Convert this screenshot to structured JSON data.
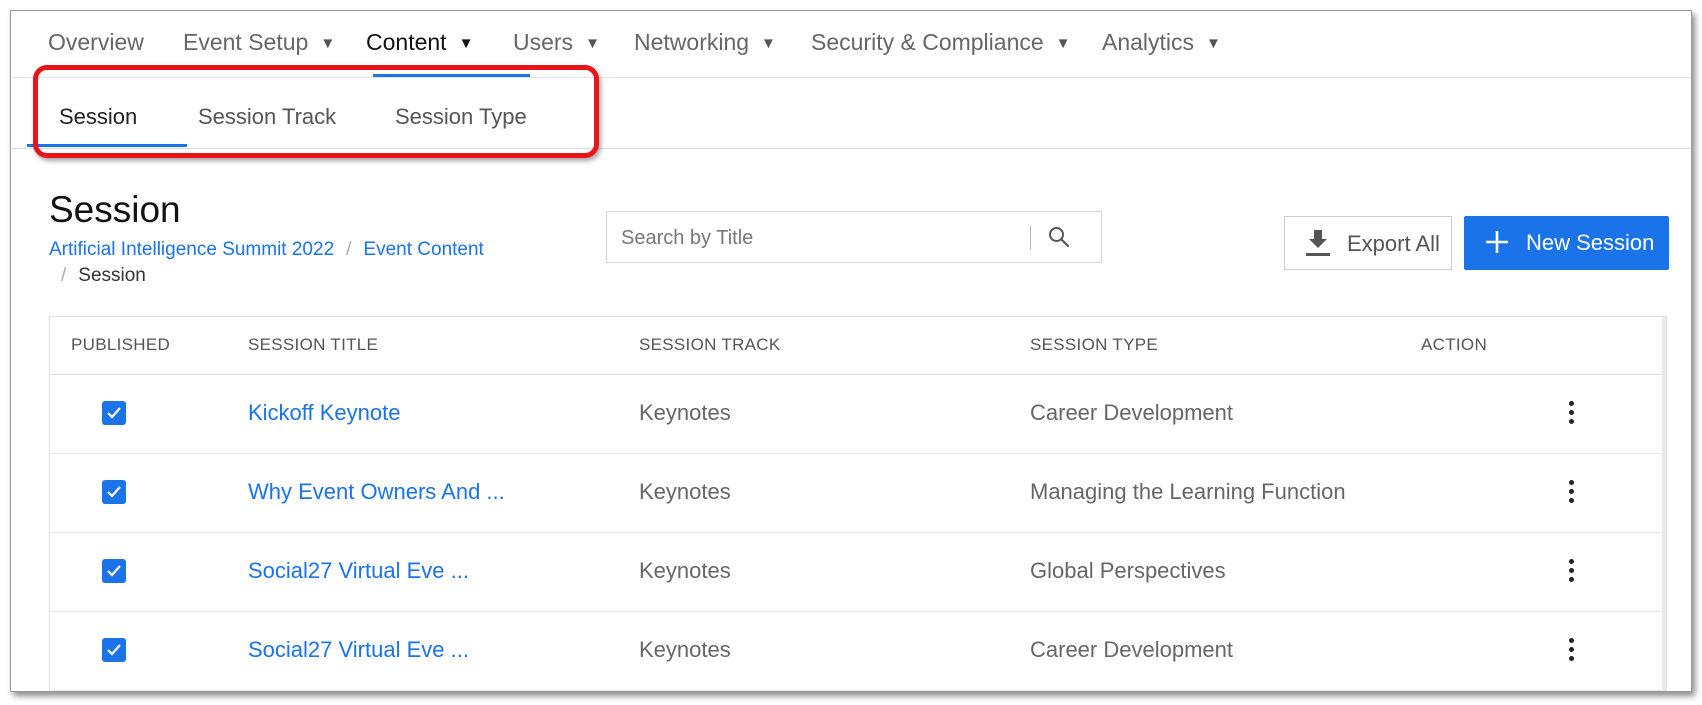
{
  "topnav": {
    "items": [
      {
        "label": "Overview",
        "caret": ""
      },
      {
        "label": "Event Setup",
        "caret": "▼"
      },
      {
        "label": "Content",
        "caret": "▼"
      },
      {
        "label": "Users",
        "caret": "▼"
      },
      {
        "label": "Networking",
        "caret": "▼"
      },
      {
        "label": "Security & Compliance",
        "caret": "▼"
      },
      {
        "label": "Analytics",
        "caret": "▼"
      }
    ],
    "active": "Content"
  },
  "subtabs": {
    "items": [
      {
        "label": "Session"
      },
      {
        "label": "Session Track"
      },
      {
        "label": "Session Type"
      }
    ],
    "active": "Session"
  },
  "page": {
    "title": "Session",
    "breadcrumb": {
      "event": "Artificial Intelligence Summit 2022",
      "section": "Event Content",
      "current": "Session",
      "separator": "/"
    }
  },
  "search": {
    "placeholder": "Search by Title",
    "value": "",
    "icon": "search-icon"
  },
  "actions": {
    "export_label": "Export All",
    "export_icon": "download-icon",
    "new_label": "New Session",
    "new_icon": "plus-icon"
  },
  "table": {
    "columns": [
      "PUBLISHED",
      "SESSION TITLE",
      "SESSION TRACK",
      "SESSION TYPE",
      "ACTION"
    ],
    "rows": [
      {
        "published": true,
        "title": "Kickoff Keynote",
        "track": "Keynotes",
        "type": "Career Development"
      },
      {
        "published": true,
        "title": "Why Event Owners And ...",
        "track": "Keynotes",
        "type": "Managing the Learning Function"
      },
      {
        "published": true,
        "title": "Social27 Virtual Eve ...",
        "track": "Keynotes",
        "type": "Global Perspectives"
      },
      {
        "published": true,
        "title": "Social27 Virtual Eve ...",
        "track": "Keynotes",
        "type": "Career Development"
      }
    ]
  },
  "colors": {
    "accent": "#1a73e8",
    "highlight": "#e8141a"
  }
}
